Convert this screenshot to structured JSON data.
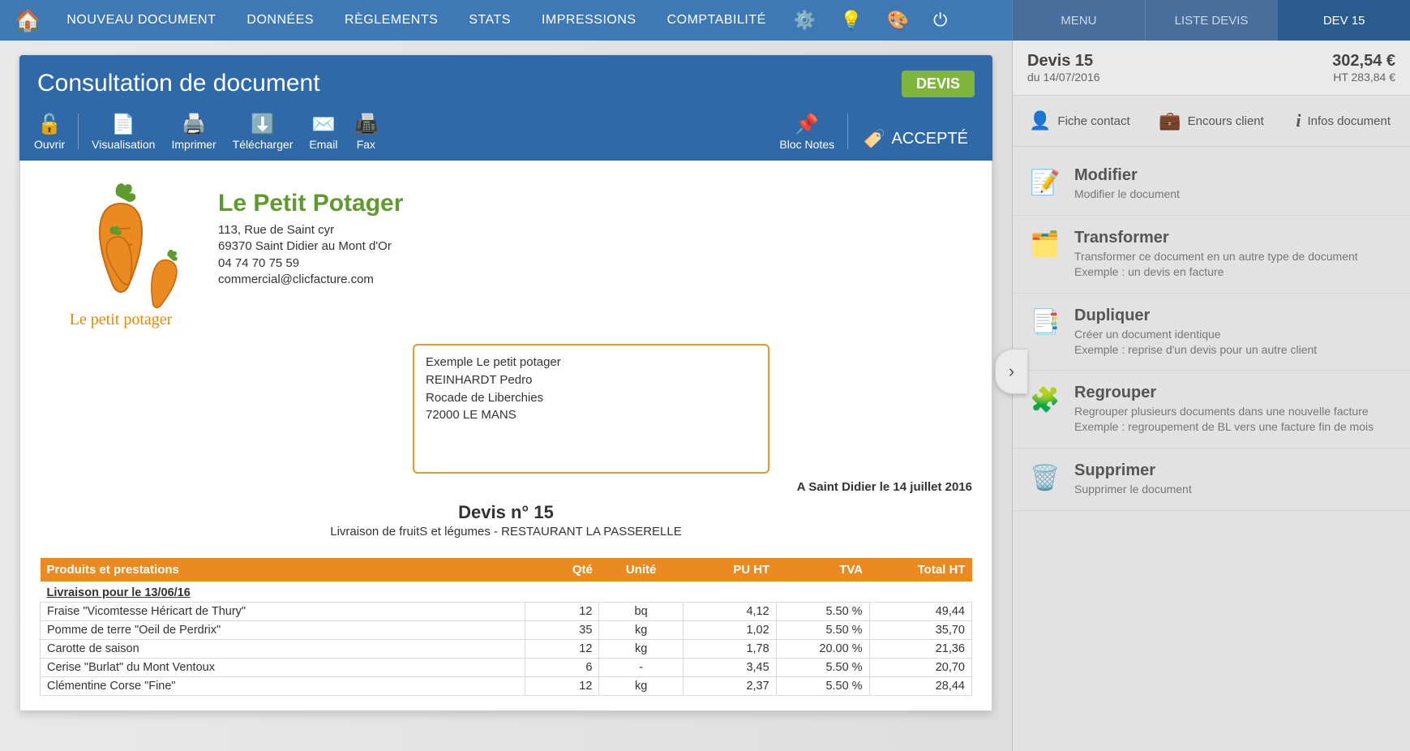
{
  "nav": {
    "items": [
      "NOUVEAU DOCUMENT",
      "DONNÉES",
      "RÈGLEMENTS",
      "STATS",
      "IMPRESSIONS",
      "COMPTABILITÉ"
    ]
  },
  "right_tabs": {
    "menu": "MENU",
    "liste": "LISTE DEVIS",
    "active": "DEV 15"
  },
  "header": {
    "title": "Consultation de document",
    "badge": "DEVIS",
    "tools": {
      "open": "Ouvrir",
      "view": "Visualisation",
      "print": "Imprimer",
      "download": "Télécharger",
      "email": "Email",
      "fax": "Fax",
      "notes": "Bloc Notes",
      "accepted": "ACCEPTÉ"
    }
  },
  "company": {
    "name": "Le Petit Potager",
    "logo_caption": "Le petit potager",
    "address1": "113, Rue de Saint cyr",
    "address2": "69370 Saint Didier au Mont d'Or",
    "phone": "04 74 70 75 59",
    "email": "commercial@clicfacture.com"
  },
  "recipient": {
    "l1": "Exemple Le petit potager",
    "l2": "REINHARDT Pedro",
    "l3": "Rocade de Liberchies",
    "l4": "72000 LE MANS"
  },
  "placedate": "A Saint Didier le 14 juillet 2016",
  "doc": {
    "title": "Devis n° 15",
    "subtitle": "Livraison de fruitS et légumes - RESTAURANT LA PASSERELLE"
  },
  "table": {
    "h_products": "Produits et prestations",
    "h_qty": "Qté",
    "h_unit": "Unité",
    "h_pu": "PU HT",
    "h_tva": "TVA",
    "h_total": "Total HT",
    "section": "Livraison pour le 13/06/16",
    "rows": [
      {
        "name": "Fraise \"Vicomtesse Héricart de Thury\"",
        "qty": "12",
        "unit": "bq",
        "pu": "4,12",
        "tva": "5.50 %",
        "total": "49,44"
      },
      {
        "name": "Pomme de terre \"Oeil de Perdrix\"",
        "qty": "35",
        "unit": "kg",
        "pu": "1,02",
        "tva": "5.50 %",
        "total": "35,70"
      },
      {
        "name": "Carotte de saison",
        "qty": "12",
        "unit": "kg",
        "pu": "1,78",
        "tva": "20.00 %",
        "total": "21,36"
      },
      {
        "name": "Cerise \"Burlat\" du Mont Ventoux",
        "qty": "6",
        "unit": "-",
        "pu": "3,45",
        "tva": "5.50 %",
        "total": "20,70"
      },
      {
        "name": "Clémentine Corse \"Fine\"",
        "qty": "12",
        "unit": "kg",
        "pu": "2,37",
        "tva": "5.50 %",
        "total": "28,44"
      }
    ]
  },
  "panel": {
    "title": "Devis 15",
    "date": "du 14/07/2016",
    "total": "302,54 €",
    "subtotal": "HT  283,84 €",
    "links": {
      "contact": "Fiche contact",
      "encours": "Encours client",
      "infos": "Infos document"
    },
    "actions": {
      "modify": {
        "t": "Modifier",
        "d": "Modifier le document"
      },
      "transform": {
        "t": "Transformer",
        "d": "Transformer ce document en un autre type de document\nExemple : un devis en facture"
      },
      "duplicate": {
        "t": "Dupliquer",
        "d": "Créer un document identique\nExemple : reprise d'un devis pour un autre client"
      },
      "group": {
        "t": "Regrouper",
        "d": "Regrouper plusieurs documents dans une nouvelle facture\nExemple : regroupement de BL vers une facture fin de mois"
      },
      "delete": {
        "t": "Supprimer",
        "d": "Supprimer le document"
      }
    }
  }
}
